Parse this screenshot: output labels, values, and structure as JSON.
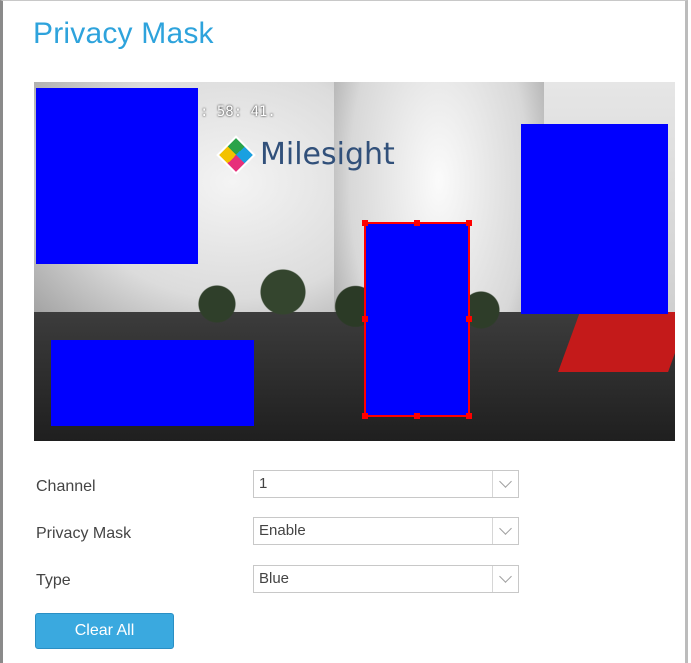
{
  "page": {
    "title": "Privacy Mask"
  },
  "preview": {
    "osd_text": ": 58: 41.",
    "logo_text": "Milesight",
    "mask_color": "#0000ff",
    "selection_color": "#ff0000"
  },
  "form": {
    "channel": {
      "label": "Channel",
      "value": "1"
    },
    "privacy_mask": {
      "label": "Privacy Mask",
      "value": "Enable"
    },
    "type": {
      "label": "Type",
      "value": "Blue"
    }
  },
  "actions": {
    "clear_all_label": "Clear All"
  },
  "colors": {
    "accent": "#2ea3dc",
    "button": "#3aa9df"
  }
}
